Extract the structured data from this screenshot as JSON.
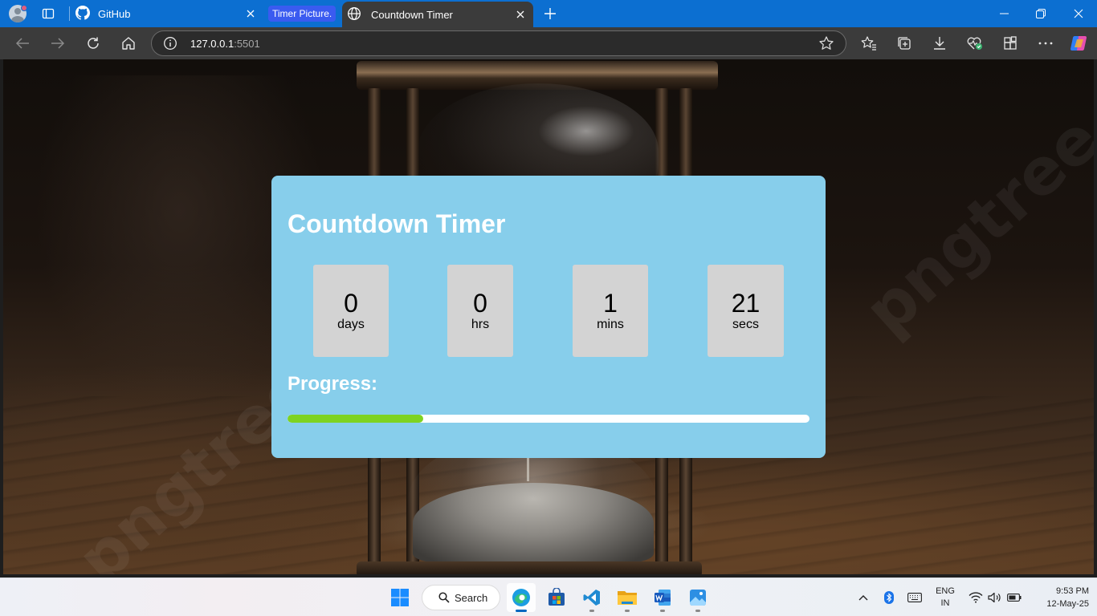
{
  "browser": {
    "tabs": [
      {
        "label": "GitHub"
      },
      {
        "label": "Countdown Timer"
      }
    ],
    "tab_group_label": "Timer Picture.",
    "address": {
      "host": "127.0.0.1",
      "port": ":5501"
    }
  },
  "timer": {
    "title": "Countdown Timer",
    "units": [
      {
        "value": "0",
        "label": "days"
      },
      {
        "value": "0",
        "label": "hrs"
      },
      {
        "value": "1",
        "label": "mins"
      },
      {
        "value": "21",
        "label": "secs"
      }
    ],
    "progress_label": "Progress:",
    "progress_fraction": 0.26,
    "progress_color": "#7ed321",
    "card_color": "#87ceeb"
  },
  "taskbar": {
    "search_label": "Search",
    "language": {
      "line1": "ENG",
      "line2": "IN"
    },
    "clock": {
      "time": "9:53 PM",
      "date": "12-May-25"
    }
  },
  "watermark": "pngtree",
  "icons": [
    "profile-icon",
    "tab-actions-icon",
    "github-icon",
    "globe-icon",
    "close-icon",
    "plus-icon",
    "minimize-icon",
    "restore-icon",
    "back-icon",
    "forward-icon",
    "refresh-icon",
    "home-icon",
    "info-icon",
    "star-icon",
    "favorites-icon",
    "collections-icon",
    "download-icon",
    "health-icon",
    "extensions-icon",
    "more-icon",
    "copilot-icon",
    "windows-start-icon",
    "edge-icon",
    "store-icon",
    "vscode-icon",
    "file-explorer-icon",
    "word-icon",
    "photos-icon",
    "chevron-up-icon",
    "bluetooth-icon",
    "keyboard-icon",
    "wifi-icon",
    "volume-icon",
    "battery-icon"
  ]
}
